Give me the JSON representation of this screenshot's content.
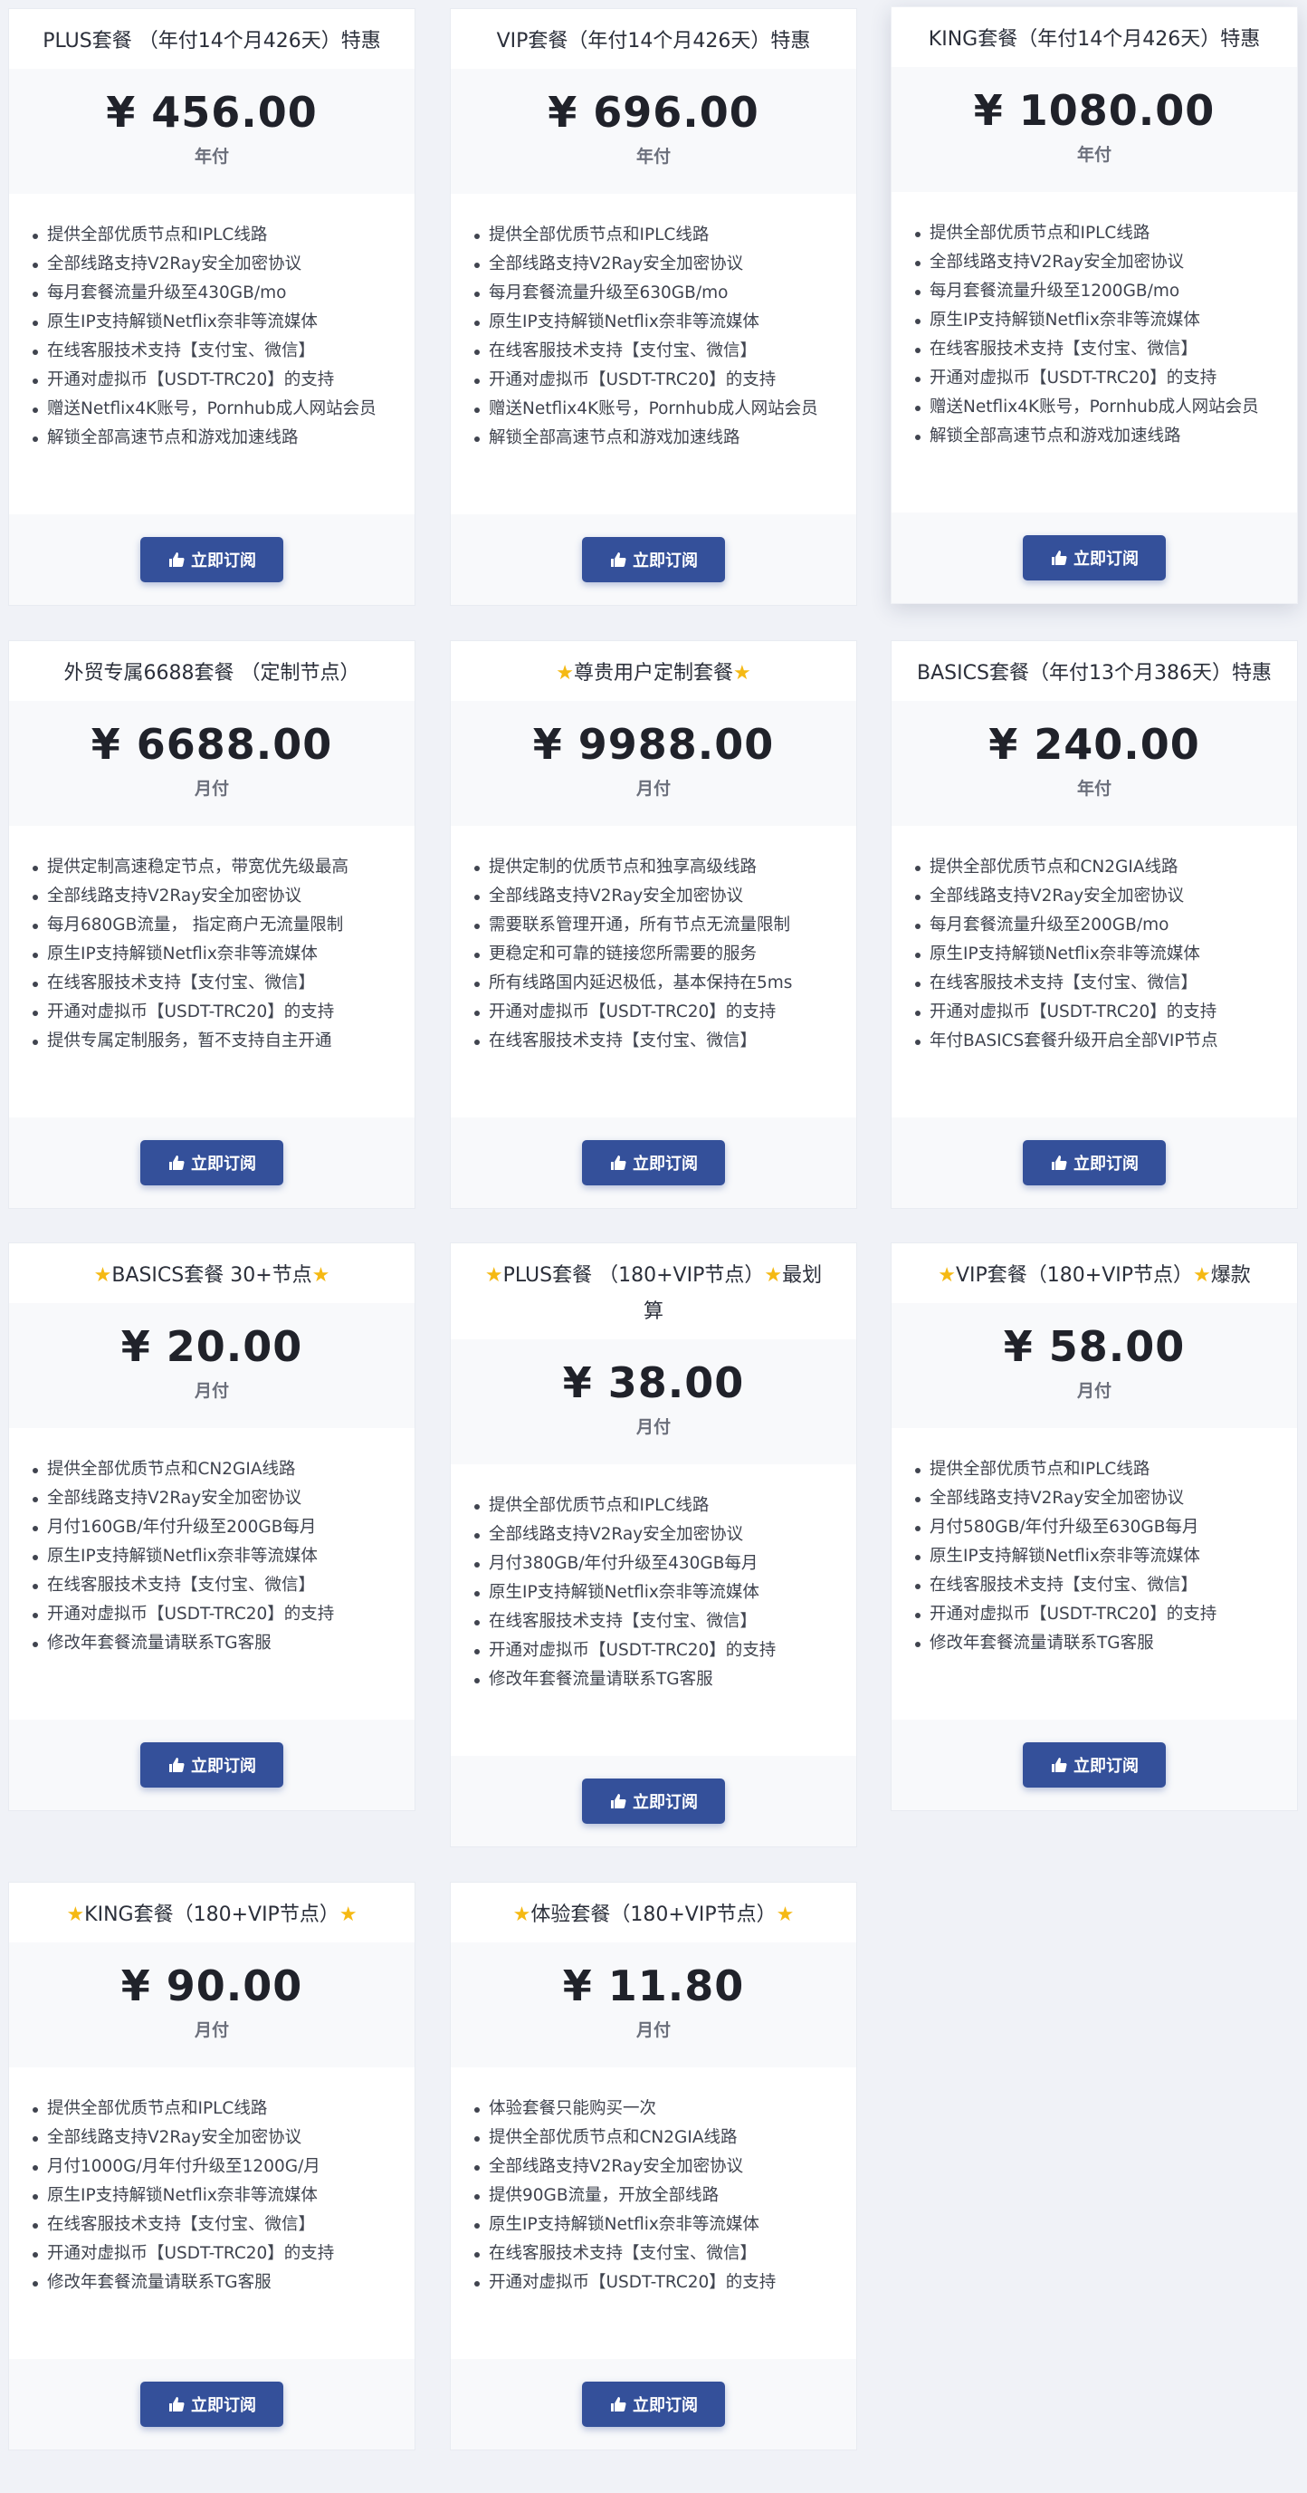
{
  "colors": {
    "page_background": "#f0f2f7",
    "button": "#34509a",
    "star": "#f5b914"
  },
  "icons": {
    "button_icon": "thumbs-up-icon",
    "title_decoration": "star-icon"
  },
  "plans": [
    {
      "title": "PLUS套餐 （年付14个月426天）特惠",
      "price": "¥ 456.00",
      "period": "年付",
      "features": [
        "提供全部优质节点和IPLC线路",
        "全部线路支持V2Ray安全加密协议",
        "每月套餐流量升级至430GB/mo",
        "原生IP支持解锁Netflix奈非等流媒体",
        "在线客服技术支持【支付宝、微信】",
        "开通对虚拟币【USDT-TRC20】的支持",
        "赠送Netflix4K账号，Pornhub成人网站会员",
        "解锁全部高速节点和游戏加速线路"
      ],
      "button": "立即订阅"
    },
    {
      "title": "VIP套餐（年付14个月426天）特惠",
      "price": "¥ 696.00",
      "period": "年付",
      "features": [
        "提供全部优质节点和IPLC线路",
        "全部线路支持V2Ray安全加密协议",
        "每月套餐流量升级至630GB/mo",
        "原生IP支持解锁Netflix奈非等流媒体",
        "在线客服技术支持【支付宝、微信】",
        "开通对虚拟币【USDT-TRC20】的支持",
        "赠送Netflix4K账号，Pornhub成人网站会员",
        "解锁全部高速节点和游戏加速线路"
      ],
      "button": "立即订阅"
    },
    {
      "title": "KING套餐（年付14个月426天）特惠",
      "price": "¥ 1080.00",
      "period": "年付",
      "features": [
        "提供全部优质节点和IPLC线路",
        "全部线路支持V2Ray安全加密协议",
        "每月套餐流量升级至1200GB/mo",
        "原生IP支持解锁Netflix奈非等流媒体",
        "在线客服技术支持【支付宝、微信】",
        "开通对虚拟币【USDT-TRC20】的支持",
        "赠送Netflix4K账号，Pornhub成人网站会员",
        "解锁全部高速节点和游戏加速线路"
      ],
      "button": "立即订阅"
    },
    {
      "title": "外贸专属6688套餐 （定制节点）",
      "price": "¥ 6688.00",
      "period": "月付",
      "features": [
        "提供定制高速稳定节点，带宽优先级最高",
        "全部线路支持V2Ray安全加密协议",
        "每月680GB流量， 指定商户无流量限制",
        "原生IP支持解锁Netflix奈非等流媒体",
        "在线客服技术支持【支付宝、微信】",
        "开通对虚拟币【USDT-TRC20】的支持",
        "提供专属定制服务，暂不支持自主开通"
      ],
      "button": "立即订阅"
    },
    {
      "title": "尊贵用户定制套餐",
      "price": "¥ 9988.00",
      "period": "月付",
      "features": [
        "提供定制的优质节点和独享高级线路",
        "全部线路支持V2Ray安全加密协议",
        "需要联系管理开通，所有节点无流量限制",
        "更稳定和可靠的链接您所需要的服务",
        "所有线路国内延迟极低，基本保持在5ms",
        "开通对虚拟币【USDT-TRC20】的支持",
        "在线客服技术支持【支付宝、微信】"
      ],
      "button": "立即订阅"
    },
    {
      "title": "BASICS套餐（年付13个月386天）特惠",
      "price": "¥ 240.00",
      "period": "年付",
      "features": [
        "提供全部优质节点和CN2GIA线路",
        "全部线路支持V2Ray安全加密协议",
        "每月套餐流量升级至200GB/mo",
        "原生IP支持解锁Netflix奈非等流媒体",
        "在线客服技术支持【支付宝、微信】",
        "开通对虚拟币【USDT-TRC20】的支持",
        "年付BASICS套餐升级开启全部VIP节点"
      ],
      "button": "立即订阅"
    },
    {
      "title": "BASICS套餐 30+节点",
      "price": "¥ 20.00",
      "period": "月付",
      "features": [
        "提供全部优质节点和CN2GIA线路",
        "全部线路支持V2Ray安全加密协议",
        "月付160GB/年付升级至200GB每月",
        "原生IP支持解锁Netflix奈非等流媒体",
        "在线客服技术支持【支付宝、微信】",
        "开通对虚拟币【USDT-TRC20】的支持",
        "修改年套餐流量请联系TG客服"
      ],
      "button": "立即订阅"
    },
    {
      "title_line1": "PLUS套餐 （180+VIP节点）",
      "title_suffix": "最划",
      "title_line2": "算",
      "price": "¥ 38.00",
      "period": "月付",
      "features": [
        "提供全部优质节点和IPLC线路",
        "全部线路支持V2Ray安全加密协议",
        "月付380GB/年付升级至430GB每月",
        "原生IP支持解锁Netflix奈非等流媒体",
        "在线客服技术支持【支付宝、微信】",
        "开通对虚拟币【USDT-TRC20】的支持",
        "修改年套餐流量请联系TG客服"
      ],
      "button": "立即订阅"
    },
    {
      "title": "VIP套餐（180+VIP节点）",
      "title_suffix": "爆款",
      "price": "¥ 58.00",
      "period": "月付",
      "features": [
        "提供全部优质节点和IPLC线路",
        "全部线路支持V2Ray安全加密协议",
        "月付580GB/年付升级至630GB每月",
        "原生IP支持解锁Netflix奈非等流媒体",
        "在线客服技术支持【支付宝、微信】",
        "开通对虚拟币【USDT-TRC20】的支持",
        "修改年套餐流量请联系TG客服"
      ],
      "button": "立即订阅"
    },
    {
      "title": "KING套餐（180+VIP节点）",
      "price": "¥ 90.00",
      "period": "月付",
      "features": [
        "提供全部优质节点和IPLC线路",
        "全部线路支持V2Ray安全加密协议",
        "月付1000G/月年付升级至1200G/月",
        "原生IP支持解锁Netflix奈非等流媒体",
        "在线客服技术支持【支付宝、微信】",
        "开通对虚拟币【USDT-TRC20】的支持",
        "修改年套餐流量请联系TG客服"
      ],
      "button": "立即订阅"
    },
    {
      "title": "体验套餐（180+VIP节点）",
      "price": "¥ 11.80",
      "period": "月付",
      "features": [
        "体验套餐只能购买一次",
        "提供全部优质节点和CN2GIA线路",
        "全部线路支持V2Ray安全加密协议",
        "提供90GB流量，开放全部线路",
        "原生IP支持解锁Netflix奈非等流媒体",
        "在线客服技术支持【支付宝、微信】",
        "开通对虚拟币【USDT-TRC20】的支持"
      ],
      "button": "立即订阅"
    }
  ]
}
